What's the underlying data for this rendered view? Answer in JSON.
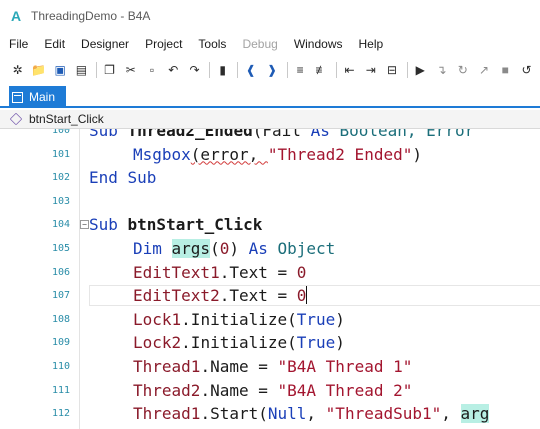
{
  "window": {
    "title": "ThreadingDemo - B4A",
    "app_icon_glyph": "A"
  },
  "menu": {
    "items": [
      {
        "label": "File",
        "enabled": true
      },
      {
        "label": "Edit",
        "enabled": true
      },
      {
        "label": "Designer",
        "enabled": true
      },
      {
        "label": "Project",
        "enabled": true
      },
      {
        "label": "Tools",
        "enabled": true
      },
      {
        "label": "Debug",
        "enabled": false
      },
      {
        "label": "Windows",
        "enabled": true
      },
      {
        "label": "Help",
        "enabled": true
      }
    ]
  },
  "toolbar": {
    "icons": [
      "new-file-icon",
      "open-folder-icon",
      "save-icon",
      "save-all-icon",
      "copy-icon",
      "cut-icon",
      "paste-icon",
      "undo-icon",
      "redo-icon",
      "bookmark-icon",
      "navigate-back-icon",
      "navigate-forward-icon",
      "comment-block-icon",
      "uncomment-block-icon",
      "outdent-icon",
      "indent-icon",
      "collapse-icon",
      "run-icon",
      "step-into-icon",
      "step-over-icon",
      "step-out-icon",
      "stop-icon",
      "restart-icon"
    ]
  },
  "tabs": {
    "active": "Main"
  },
  "subnav": {
    "current_sub": "btnStart_Click"
  },
  "editor": {
    "line_numbers": [
      "100",
      "101",
      "102",
      "103",
      "104",
      "105",
      "106",
      "107",
      "108",
      "109",
      "110",
      "111",
      "112"
    ],
    "lines": {
      "l100": {
        "a": "Sub ",
        "b": "Thread2_Ended",
        "c": "(Fail ",
        "d": "As",
        "e": " Boolean, Error"
      },
      "l101": {
        "a": "Msgbox",
        "b": "(error, ",
        "c": "\"Thread2 Ended\"",
        "d": ")"
      },
      "l102": {
        "a": "End Sub"
      },
      "l104": {
        "a": "Sub ",
        "b": "btnStart_Click"
      },
      "l105": {
        "a": "Dim ",
        "b": "args",
        "c": "(",
        "d": "0",
        "e": ") ",
        "f": "As",
        "g": " Object"
      },
      "l106": {
        "a": "EditText1",
        "b": ".Text = ",
        "c": "0"
      },
      "l107": {
        "a": "EditText2",
        "b": ".Text = ",
        "c": "0"
      },
      "l108": {
        "a": "Lock1",
        "b": ".Initialize(",
        "c": "True",
        "d": ")"
      },
      "l109": {
        "a": "Lock2",
        "b": ".Initialize(",
        "c": "True",
        "d": ")"
      },
      "l110": {
        "a": "Thread1",
        "b": ".Name = ",
        "c": "\"B4A Thread 1\""
      },
      "l111": {
        "a": "Thread2",
        "b": ".Name = ",
        "c": "\"B4A Thread 2\""
      },
      "l112": {
        "a": "Thread1",
        "b": ".Start(",
        "c": "Null",
        "d": ", ",
        "e": "\"ThreadSub1\"",
        "f": ", ",
        "g": "arg"
      }
    }
  },
  "colors": {
    "accent": "#1e7bd6",
    "keyword": "#1a3fb8",
    "string": "#a3152f",
    "line_number": "#2a8da8",
    "highlight": "#b8efe4"
  }
}
